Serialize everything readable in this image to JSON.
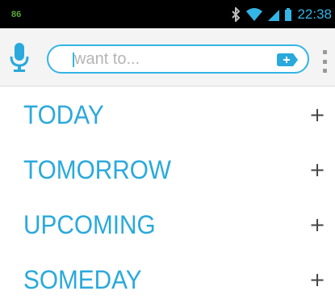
{
  "status_bar": {
    "left_indicator": "86",
    "time": "22:38",
    "icons": [
      "bluetooth-icon",
      "wifi-icon",
      "signal-icon",
      "battery-icon"
    ]
  },
  "toolbar": {
    "mic_icon": "microphone-icon",
    "search": {
      "placeholder": "want to...",
      "value": ""
    },
    "tag_icon": "add-tag-icon",
    "overflow_icon": "overflow-menu-icon"
  },
  "lists": [
    {
      "label": "TODAY",
      "add": "+"
    },
    {
      "label": "TOMORROW",
      "add": "+"
    },
    {
      "label": "UPCOMING",
      "add": "+"
    },
    {
      "label": "SOMEDAY",
      "add": "+"
    }
  ],
  "colors": {
    "accent": "#33b5e5",
    "label": "#2aa9dc",
    "status_bg": "#000000",
    "toolbar_bg": "#f4f4f4"
  }
}
